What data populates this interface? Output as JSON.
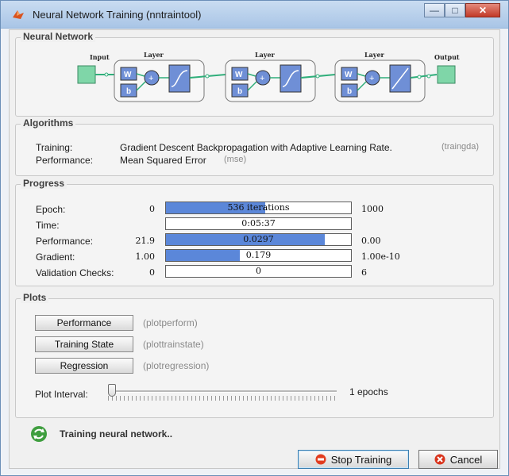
{
  "window": {
    "title": "Neural Network Training (nntraintool)",
    "icon": "matlab-icon",
    "controls": [
      "minimize",
      "maximize",
      "close"
    ]
  },
  "neural_network": {
    "group_title": "Neural Network",
    "input_label": "Input",
    "output_label": "Output",
    "layers": [
      {
        "title": "Layer",
        "w_label": "W",
        "b_label": "b",
        "sum_symbol": "+",
        "transfer": "tansig"
      },
      {
        "title": "Layer",
        "w_label": "W",
        "b_label": "b",
        "sum_symbol": "+",
        "transfer": "tansig"
      },
      {
        "title": "Layer",
        "w_label": "W",
        "b_label": "b",
        "sum_symbol": "+",
        "transfer": "purelin"
      }
    ]
  },
  "algorithms": {
    "group_title": "Algorithms",
    "training_label": "Training:",
    "training_value": "Gradient Descent Backpropagation with Adaptive Learning Rate.",
    "training_hint": "(traingda)",
    "performance_label": "Performance:",
    "performance_value": "Mean Squared Error",
    "performance_hint": "(mse)"
  },
  "progress": {
    "group_title": "Progress",
    "rows": [
      {
        "label": "Epoch:",
        "min": "0",
        "current": "536 iterations",
        "max": "1000",
        "fill": 0.536
      },
      {
        "label": "Time:",
        "min": "",
        "current": "0:05:37",
        "max": "",
        "fill": 0
      },
      {
        "label": "Performance:",
        "min": "21.9",
        "current": "0.0297",
        "max": "0.00",
        "fill": 0.86
      },
      {
        "label": "Gradient:",
        "min": "1.00",
        "current": "0.179",
        "max": "1.00e-10",
        "fill": 0.4
      },
      {
        "label": "Validation Checks:",
        "min": "0",
        "current": "0",
        "max": "6",
        "fill": 0
      }
    ]
  },
  "plots": {
    "group_title": "Plots",
    "buttons": [
      {
        "label": "Performance",
        "hint": "(plotperform)"
      },
      {
        "label": "Training State",
        "hint": "(plottrainstate)"
      },
      {
        "label": "Regression",
        "hint": "(plotregression)"
      }
    ],
    "interval_label": "Plot Interval:",
    "interval_value": "1 epochs",
    "interval_level": 0
  },
  "status": {
    "icon": "recycle-icon",
    "text": "Training neural network.."
  },
  "actions": {
    "stop_label": "Stop Training",
    "cancel_label": "Cancel"
  },
  "colors": {
    "progress_fill": "#5b87d9",
    "block_fill": "#6f8fd6",
    "io_fill": "#7fd6a8",
    "wire": "#2fae7a"
  }
}
